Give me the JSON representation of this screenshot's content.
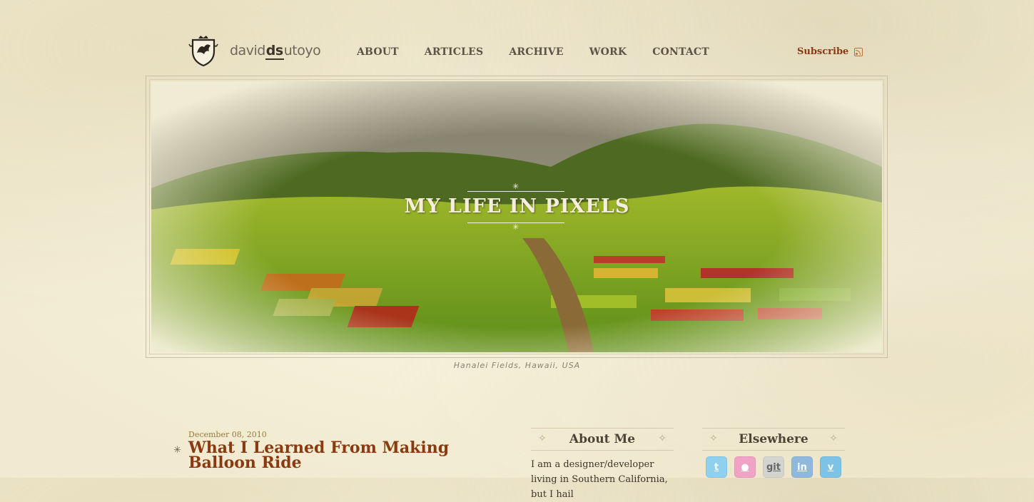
{
  "header": {
    "logo_prefix": "david",
    "logo_mono": "ds",
    "logo_suffix": "utoyo",
    "nav": [
      "ABOUT",
      "ARTICLES",
      "ARCHIVE",
      "WORK",
      "CONTACT"
    ],
    "subscribe_label": "Subscribe"
  },
  "hero": {
    "title": "MY LIFE IN PIXELS",
    "caption": "Hanalei Fields, Hawaii, USA"
  },
  "post": {
    "date": "December 08, 2010",
    "title": "What I Learned From Making Balloon Ride"
  },
  "sidebar": {
    "about_title": "About Me",
    "about_text": "I am a designer/developer living in Southern California, but I hail",
    "elsewhere_title": "Elsewhere",
    "social": [
      {
        "icon": "twitter-icon",
        "label": "t",
        "color": "#8fd0ef"
      },
      {
        "icon": "dribbble-icon",
        "label": "●",
        "color": "#f0a3c5"
      },
      {
        "icon": "github-icon",
        "label": "git",
        "color": "#d3d3d0"
      },
      {
        "icon": "linkedin-icon",
        "label": "in",
        "color": "#8fb8dc"
      },
      {
        "icon": "vimeo-icon",
        "label": "v",
        "color": "#7ec3e6"
      }
    ]
  },
  "colors": {
    "accent": "#8a3a10",
    "text": "#4a3b2a",
    "background": "#f6f1da"
  }
}
